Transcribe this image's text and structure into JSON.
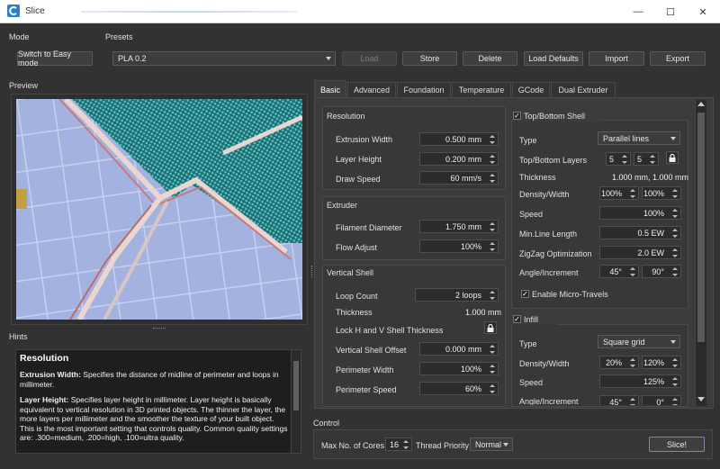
{
  "window": {
    "title": "Slice",
    "minimize_icon": "—",
    "maximize_icon": "☐",
    "close_icon": "✕"
  },
  "mode": {
    "label": "Mode",
    "switch_button": "Switch to Easy mode"
  },
  "presets": {
    "label": "Presets",
    "selected": "PLA 0.2",
    "buttons": {
      "load": "Load",
      "store": "Store",
      "delete": "Delete",
      "load_defaults": "Load Defaults",
      "import": "Import",
      "export": "Export"
    }
  },
  "preview": {
    "label": "Preview"
  },
  "hints": {
    "label": "Hints",
    "title": "Resolution",
    "extrusion_width_term": "Extrusion Width:",
    "extrusion_width_text": " Specifies the distance of midline of perimeter and loops in millimeter.",
    "layer_height_term": "Layer Height:",
    "layer_height_text": " Specifies layer height in millimeter. Layer height is basically equivalent to vertical resolution in 3D printed objects. The thinner the layer, the more layers per millimeter and the smoother the texture of your built object. This is the most important setting that controls quality. Common quality settings are: .300=medium, .200=high, .100=ultra quality."
  },
  "tabs": [
    "Basic",
    "Advanced",
    "Foundation",
    "Temperature",
    "GCode",
    "Dual Extruder"
  ],
  "resolution": {
    "title": "Resolution",
    "extrusion_width": {
      "label": "Extrusion Width",
      "value": "0.500 mm"
    },
    "layer_height": {
      "label": "Layer Height",
      "value": "0.200 mm"
    },
    "draw_speed": {
      "label": "Draw Speed",
      "value": "60 mm/s"
    }
  },
  "extruder": {
    "title": "Extruder",
    "filament_diameter": {
      "label": "Filament Diameter",
      "value": "1.750 mm"
    },
    "flow_adjust": {
      "label": "Flow Adjust",
      "value": "100%"
    }
  },
  "vertical_shell": {
    "title": "Vertical Shell",
    "loop_count": {
      "label": "Loop Count",
      "value": "2 loops"
    },
    "thickness": {
      "label": "Thickness",
      "value": "1.000 mm"
    },
    "lock_hv": {
      "label": "Lock H and V Shell Thickness"
    },
    "offset": {
      "label": "Vertical Shell Offset",
      "value": "0.000 mm"
    },
    "perimeter_width": {
      "label": "Perimeter Width",
      "value": "100%"
    },
    "perimeter_speed": {
      "label": "Perimeter Speed",
      "value": "60%"
    }
  },
  "top_bottom": {
    "title": "Top/Bottom Shell",
    "checked": true,
    "type": {
      "label": "Type",
      "value": "Parallel lines"
    },
    "layers": {
      "label": "Top/Bottom Layers",
      "top": "5",
      "bottom": "5"
    },
    "thickness": {
      "label": "Thickness",
      "value": "1.000 mm, 1.000 mm"
    },
    "density_width": {
      "label": "Density/Width",
      "density": "100%",
      "width": "100%"
    },
    "speed": {
      "label": "Speed",
      "value": "100%"
    },
    "min_line_length": {
      "label": "Min.Line Length",
      "value": "0.5 EW"
    },
    "zigzag": {
      "label": "ZigZag Optimization",
      "value": "2.0 EW"
    },
    "angle": {
      "label": "Angle/Increment",
      "angle": "45°",
      "increment": "90°"
    },
    "micro_travels": {
      "label": "Enable Micro-Travels",
      "checked": true
    }
  },
  "infill": {
    "title": "Infill",
    "checked": true,
    "type": {
      "label": "Type",
      "value": "Square grid"
    },
    "density_width": {
      "label": "Density/Width",
      "density": "20%",
      "width": "120%"
    },
    "speed": {
      "label": "Speed",
      "value": "125%"
    },
    "angle": {
      "label": "Angle/Increment",
      "angle": "45°",
      "increment": "0°"
    }
  },
  "control": {
    "label": "Control",
    "cores_label": "Max No. of Cores",
    "cores_value": "16",
    "priority_label": "Thread Priority",
    "priority_value": "Normal",
    "slice_button": "Slice!"
  },
  "colors": {
    "background": "#323232",
    "panel": "#383838",
    "field": "#2c2c2c",
    "preview_glass": "#9aa9d8",
    "infill_teal": "#3fa7a4"
  }
}
